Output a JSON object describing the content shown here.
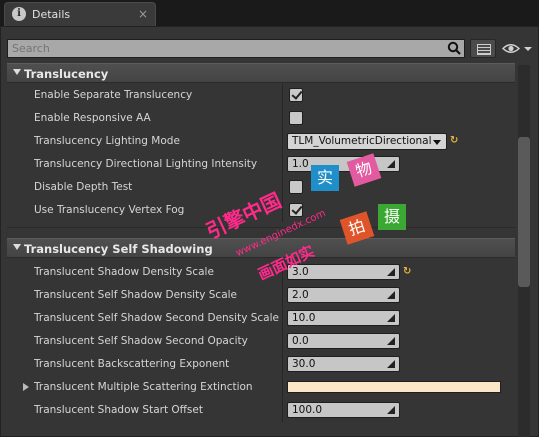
{
  "tab": {
    "icon": "info-icon",
    "title": "Details",
    "close": "×"
  },
  "search": {
    "placeholder": "Search",
    "value": ""
  },
  "sections": {
    "translucency": {
      "title": "Translucency",
      "rows": {
        "separate": {
          "label": "Enable Separate Translucency",
          "checked": true
        },
        "responsive_aa": {
          "label": "Enable Responsive AA",
          "checked": false
        },
        "lighting_mode": {
          "label": "Translucency Lighting Mode",
          "value": "TLM_VolumetricDirectional",
          "reset": "↻"
        },
        "dir_intensity": {
          "label": "Translucency Directional Lighting Intensity",
          "value": "1.0"
        },
        "depth_test": {
          "label": "Disable Depth Test",
          "checked": false
        },
        "vertex_fog": {
          "label": "Use Translucency Vertex Fog",
          "checked": true
        }
      }
    },
    "self_shadowing": {
      "title": "Translucency Self Shadowing",
      "rows": {
        "density_scale": {
          "label": "Translucent Shadow Density Scale",
          "value": "3.0",
          "reset": "↻"
        },
        "self_density": {
          "label": "Translucent Self Shadow Density Scale",
          "value": "2.0"
        },
        "second_density": {
          "label": "Translucent Self Shadow Second Density Scale",
          "value": "10.0"
        },
        "second_opacity": {
          "label": "Translucent Self Shadow Second Opacity",
          "value": "0.0"
        },
        "backscatter": {
          "label": "Translucent Backscattering Exponent",
          "value": "30.0"
        },
        "multi_scatter": {
          "label": "Translucent Multiple Scattering Extinction",
          "color": "#fbe7c8"
        },
        "start_offset": {
          "label": "Translucent Shadow Start Offset",
          "value": "100.0"
        }
      }
    }
  },
  "watermark": {
    "line1": "引擎中国",
    "line2": "www.enginedx.com",
    "line3": "画面如实",
    "boxes": [
      "实",
      "物",
      "拍",
      "摄"
    ]
  }
}
